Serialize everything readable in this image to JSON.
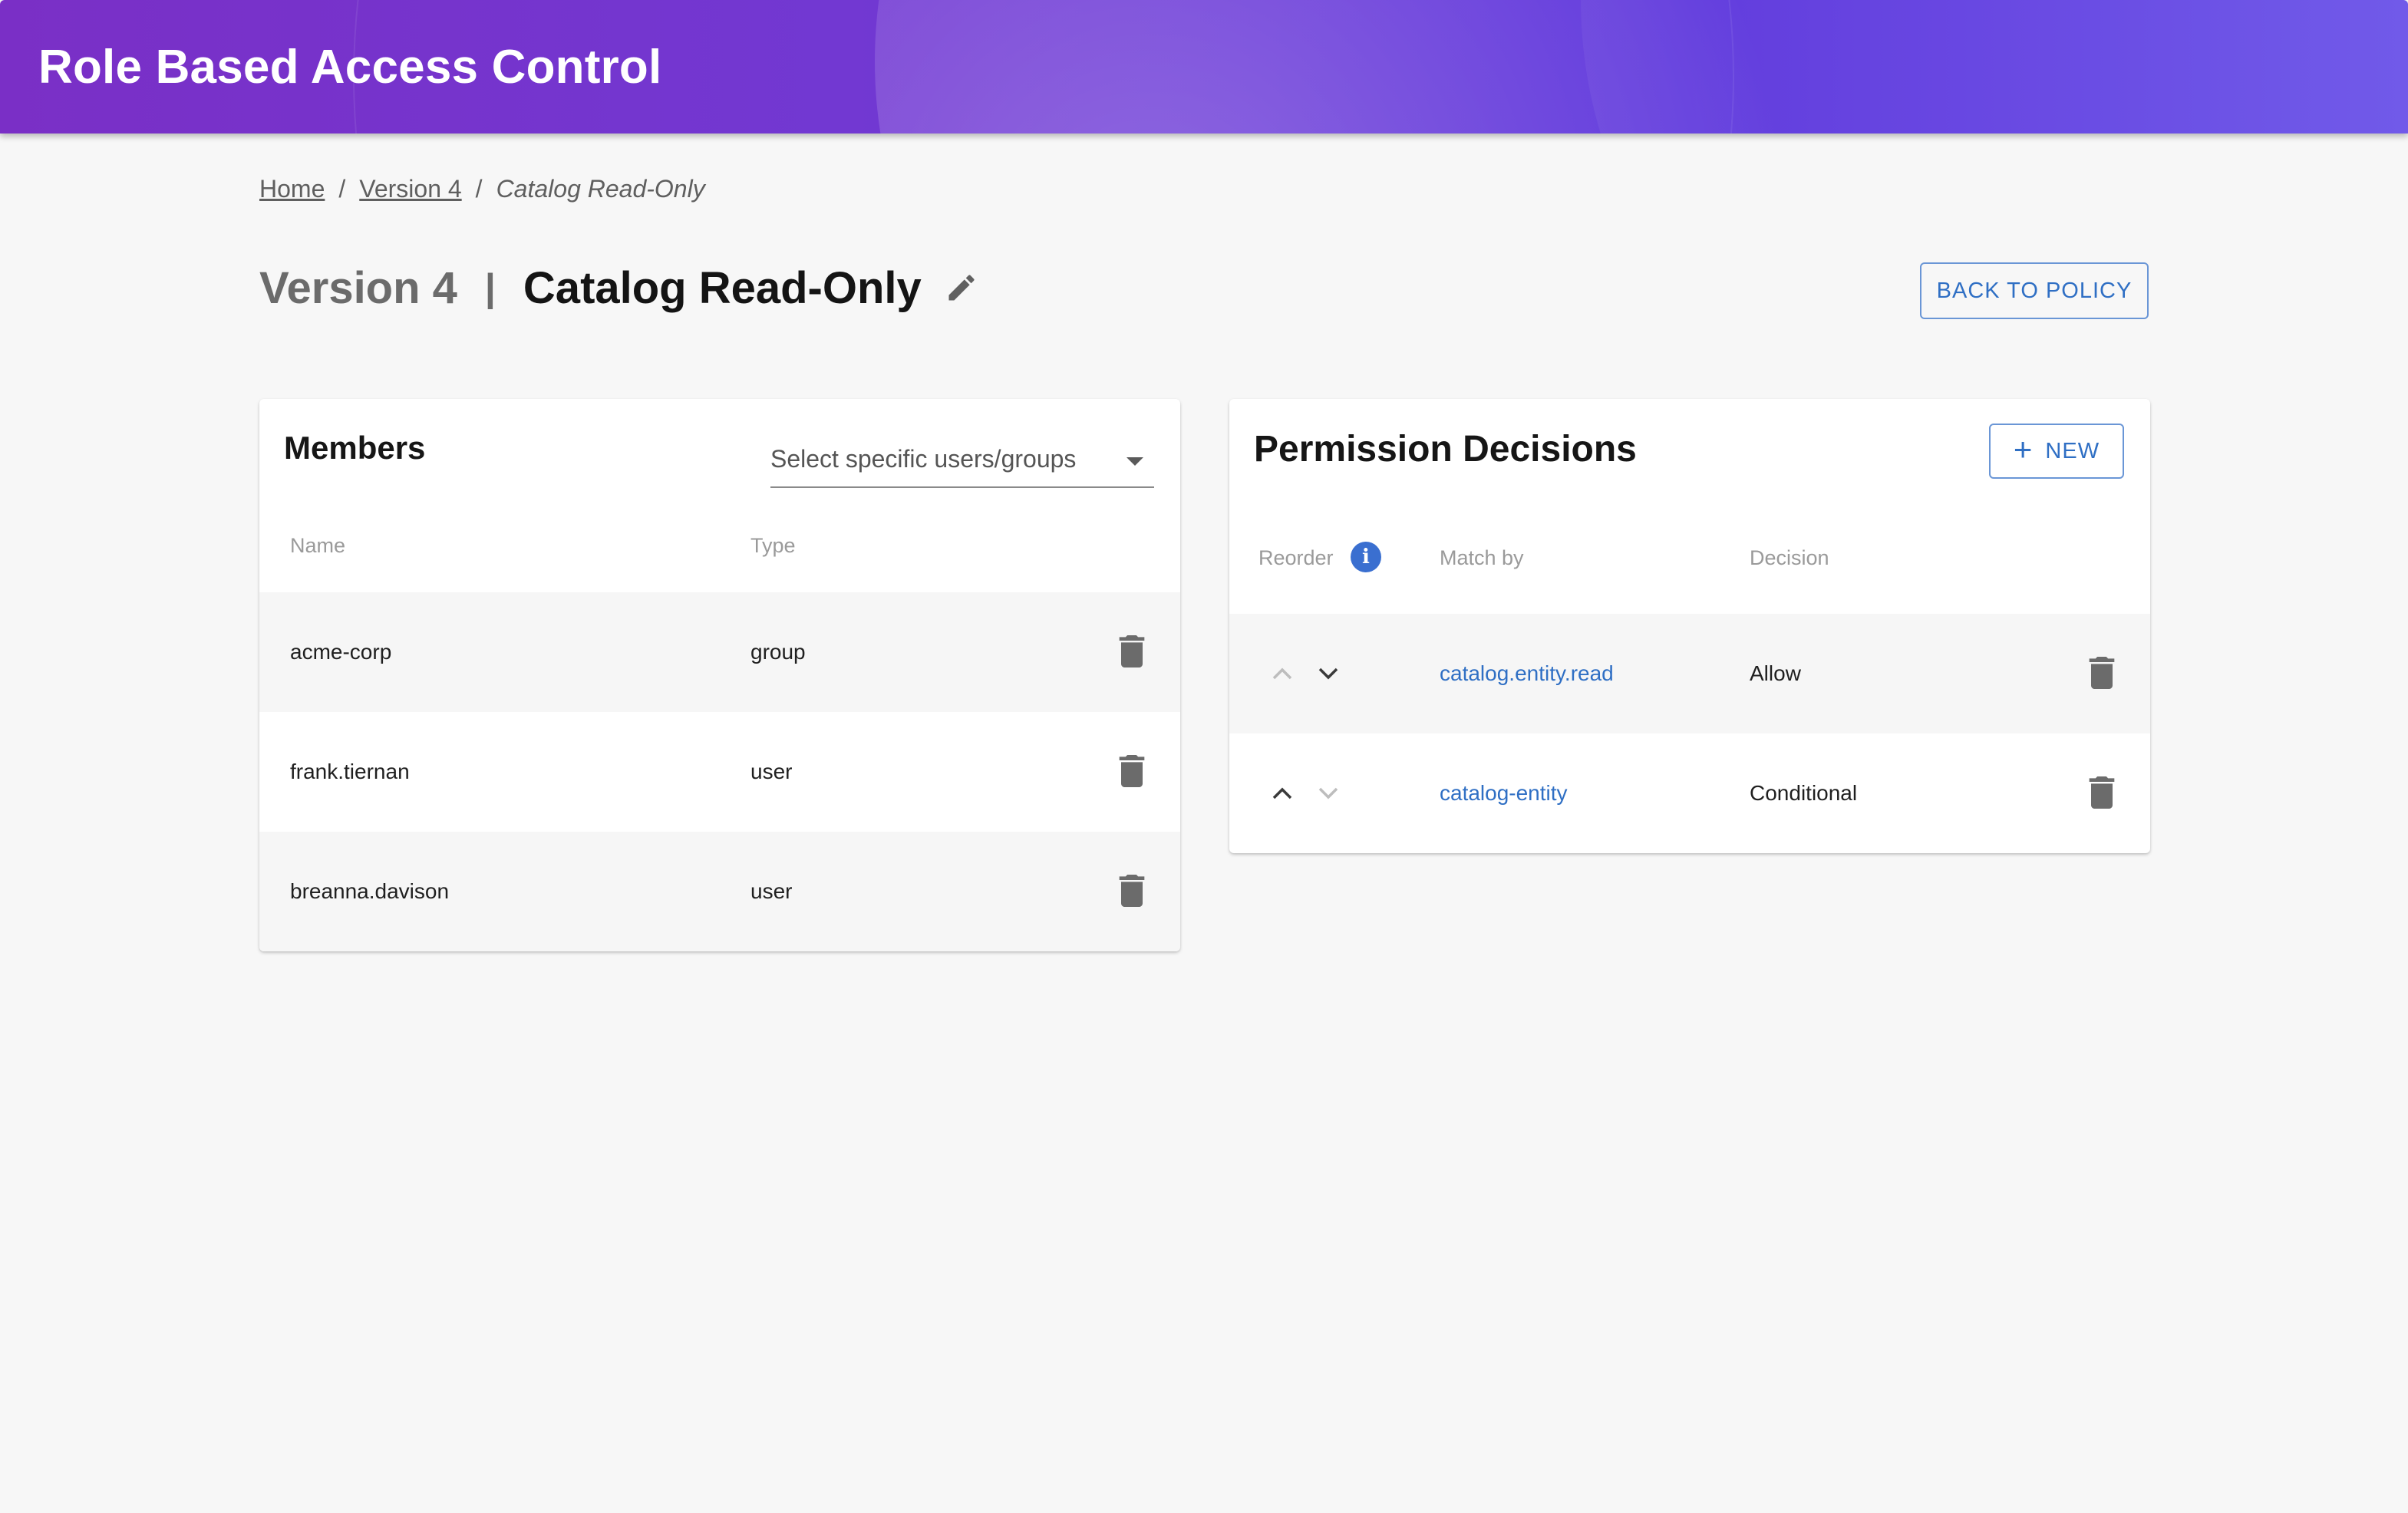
{
  "header": {
    "title": "Role Based Access Control"
  },
  "breadcrumb": {
    "items": [
      "Home",
      "Version 4"
    ],
    "current": "Catalog Read-Only",
    "separator": "/"
  },
  "page": {
    "version": "Version 4",
    "divider": "|",
    "role_name": "Catalog Read-Only",
    "back_button": "BACK TO POLICY"
  },
  "members": {
    "title": "Members",
    "select_placeholder": "Select specific users/groups",
    "columns": {
      "name": "Name",
      "type": "Type"
    },
    "rows": [
      {
        "name": "acme-corp",
        "type": "group"
      },
      {
        "name": "frank.tiernan",
        "type": "user"
      },
      {
        "name": "breanna.davison",
        "type": "user"
      }
    ]
  },
  "permissions": {
    "title": "Permission Decisions",
    "new_button": "NEW",
    "columns": {
      "reorder": "Reorder",
      "match_by": "Match by",
      "decision": "Decision"
    },
    "rows": [
      {
        "match_by": "catalog.entity.read",
        "decision": "Allow"
      },
      {
        "match_by": "catalog-entity",
        "decision": "Conditional"
      }
    ]
  },
  "colors": {
    "header_gradient_start": "#7a2fc6",
    "header_gradient_end": "#6a52e8",
    "accent_blue": "#2f6fc4"
  }
}
